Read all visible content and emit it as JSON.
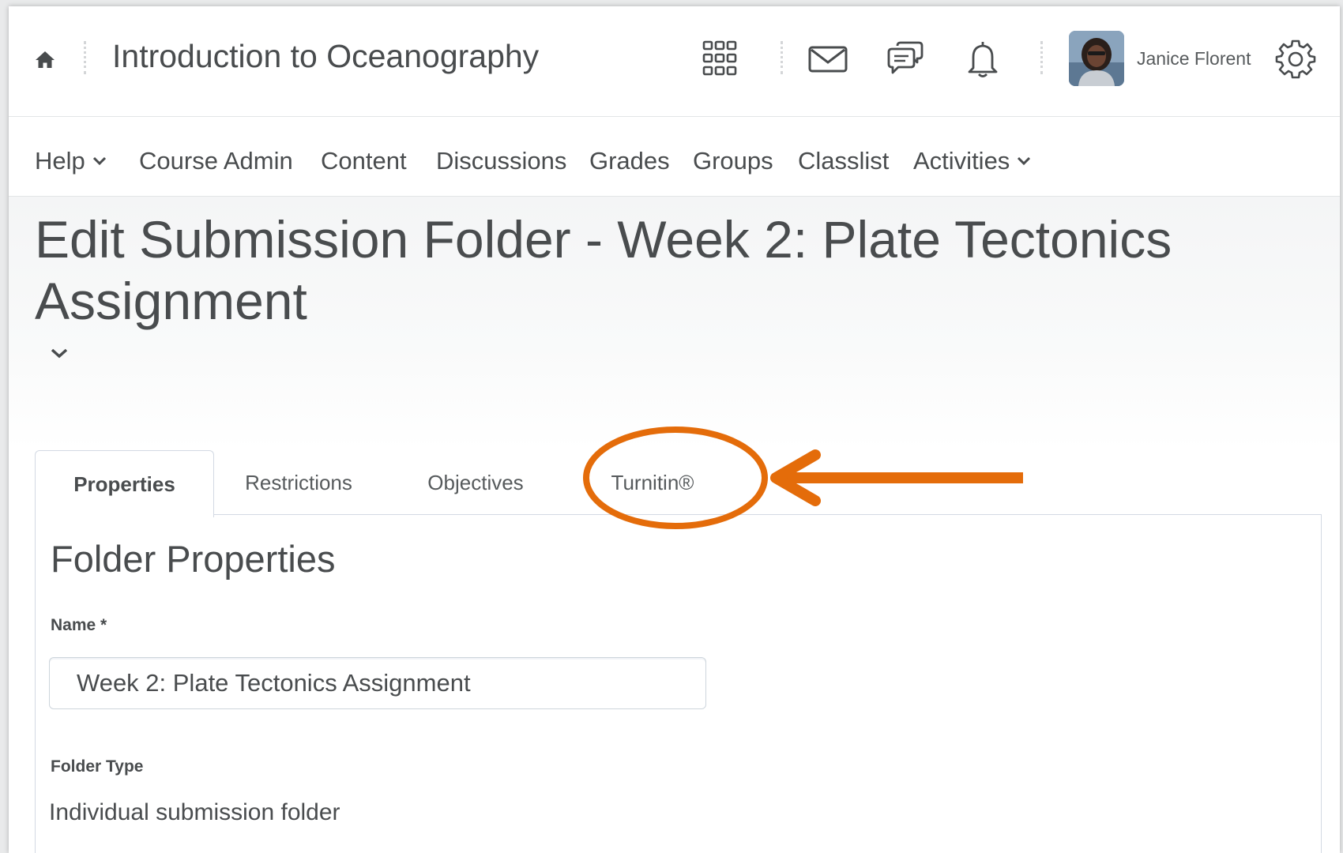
{
  "topbar": {
    "course_title": "Introduction to Oceanography",
    "user_name": "Janice Florent",
    "icons": [
      "home-icon",
      "waffle-grid-icon",
      "mail-icon",
      "chat-icon",
      "bell-icon",
      "gear-icon"
    ]
  },
  "nav": {
    "items": [
      {
        "label": "Help",
        "dropdown": true
      },
      {
        "label": "Course Admin"
      },
      {
        "label": "Content"
      },
      {
        "label": "Discussions"
      },
      {
        "label": "Grades"
      },
      {
        "label": "Groups"
      },
      {
        "label": "Classlist"
      },
      {
        "label": "Activities",
        "dropdown": true
      }
    ]
  },
  "page": {
    "title": "Edit Submission Folder - Week 2: Plate Tectonics Assignment"
  },
  "tabs": [
    {
      "label": "Properties",
      "active": true
    },
    {
      "label": "Restrictions",
      "active": false
    },
    {
      "label": "Objectives",
      "active": false
    },
    {
      "label": "Turnitin®",
      "active": false,
      "highlighted": true
    }
  ],
  "form": {
    "section_title": "Folder Properties",
    "name_label": "Name *",
    "name_value": "Week 2: Plate Tectonics Assignment",
    "folder_type_label": "Folder Type",
    "folder_type_value": "Individual submission folder"
  },
  "colors": {
    "annotation": "#e46c0a",
    "text": "#494c4e",
    "border": "#d3d9e3"
  }
}
